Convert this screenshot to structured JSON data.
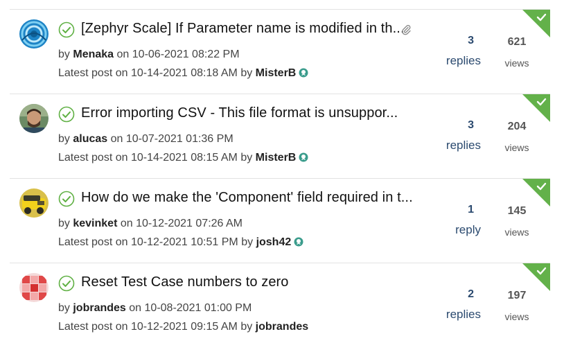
{
  "colors": {
    "accent_green": "#5fb043",
    "solved_green": "#63b14a",
    "reply_blue": "#2b4a6f",
    "rank_teal": "#3a9c8c"
  },
  "threads": [
    {
      "subject": "[Zephyr Scale] If Parameter name is modified in th...",
      "has_attachment": true,
      "by_prefix": "by",
      "author": "Menaka",
      "on_word": "on",
      "posted": "10-06-2021 08:22 PM",
      "latest_prefix": "Latest post on",
      "latest_time": "10-14-2021 08:18 AM",
      "latest_by": "by",
      "latest_author": "MisterB",
      "latest_author_ranked": true,
      "replies_count": "3",
      "replies_label": "replies",
      "views_count": "621",
      "views_label": "views",
      "avatar_icon": "blue-swirl-avatar",
      "solved": true
    },
    {
      "subject": "Error importing CSV - This file format is unsuppor...",
      "has_attachment": false,
      "by_prefix": "by",
      "author": "alucas",
      "on_word": "on",
      "posted": "10-07-2021 01:36 PM",
      "latest_prefix": "Latest post on",
      "latest_time": "10-14-2021 08:15 AM",
      "latest_by": "by",
      "latest_author": "MisterB",
      "latest_author_ranked": true,
      "replies_count": "3",
      "replies_label": "replies",
      "views_count": "204",
      "views_label": "views",
      "avatar_icon": "person-photo-avatar",
      "solved": true
    },
    {
      "subject": "How do we make the 'Component' field required in t...",
      "has_attachment": false,
      "by_prefix": "by",
      "author": "kevinket",
      "on_word": "on",
      "posted": "10-12-2021 07:26 AM",
      "latest_prefix": "Latest post on",
      "latest_time": "10-12-2021 10:51 PM",
      "latest_by": "by",
      "latest_author": "josh42",
      "latest_author_ranked": true,
      "replies_count": "1",
      "replies_label": "reply",
      "views_count": "145",
      "views_label": "views",
      "avatar_icon": "yellow-vehicle-avatar",
      "solved": true
    },
    {
      "subject": "Reset Test Case numbers to zero",
      "has_attachment": false,
      "by_prefix": "by",
      "author": "jobrandes",
      "on_word": "on",
      "posted": "10-08-2021 01:00 PM",
      "latest_prefix": "Latest post on",
      "latest_time": "10-12-2021 09:15 AM",
      "latest_by": "by",
      "latest_author": "jobrandes",
      "latest_author_ranked": false,
      "replies_count": "2",
      "replies_label": "replies",
      "views_count": "197",
      "views_label": "views",
      "avatar_icon": "red-cube-avatar",
      "solved": true
    }
  ]
}
